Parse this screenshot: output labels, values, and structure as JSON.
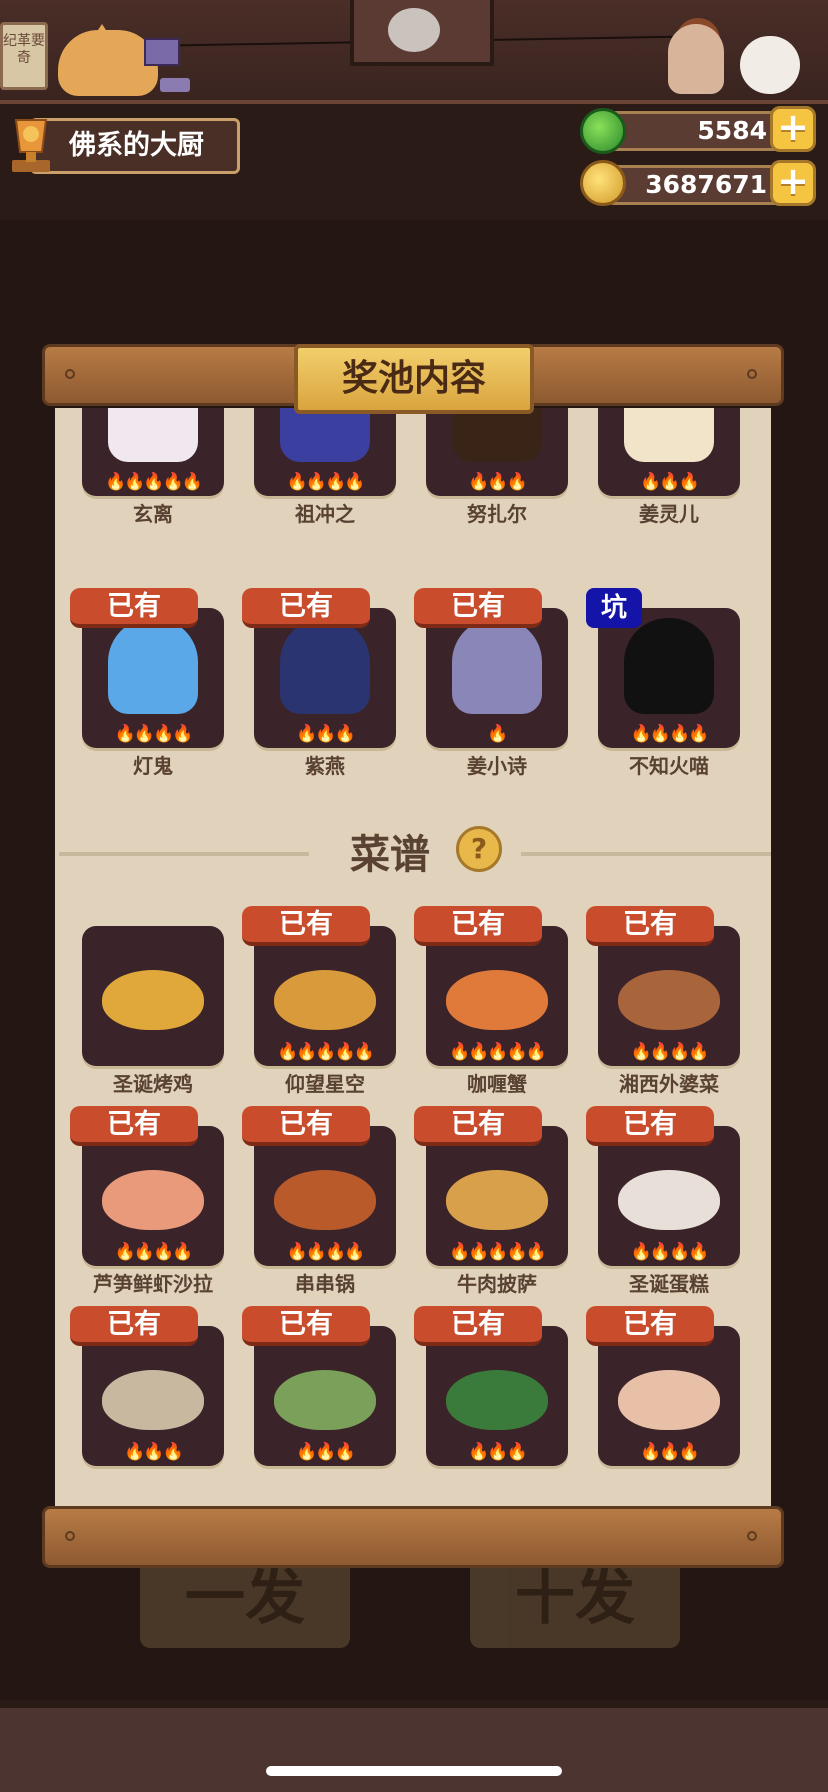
{
  "hud": {
    "player_name": "佛系的大厨",
    "jade": "5584",
    "coins": "3687671",
    "plus": "+",
    "sign_text": "纪革要奇"
  },
  "background_buttons": {
    "single": "一发",
    "ten": "十发"
  },
  "panel": {
    "title": "奖池内容",
    "recipes_section": "菜谱",
    "help": "?"
  },
  "badges": {
    "owned": "已有",
    "pit": "坑"
  },
  "characters": [
    {
      "name": "玄离",
      "flames": "🔥🔥🔥🔥🔥",
      "owned": false,
      "color": "#f0e8ee"
    },
    {
      "name": "祖冲之",
      "flames": "🔥🔥🔥🔥",
      "owned": false,
      "color": "#3a3fa0"
    },
    {
      "name": "努扎尔",
      "flames": "🔥🔥🔥",
      "owned": false,
      "color": "#3a2418"
    },
    {
      "name": "姜灵儿",
      "flames": "🔥🔥🔥",
      "owned": false,
      "color": "#f2e4c8"
    },
    {
      "name": "灯鬼",
      "flames": "🔥🔥🔥🔥",
      "owned": true,
      "color": "#5aa8e8"
    },
    {
      "name": "紫燕",
      "flames": "🔥🔥🔥",
      "owned": true,
      "color": "#2a3470"
    },
    {
      "name": "姜小诗",
      "flames": "🔥",
      "owned": true,
      "color": "#8a86b8"
    },
    {
      "name": "不知火喵",
      "flames": "🔥🔥🔥🔥",
      "owned": false,
      "pit": true,
      "color": "#111111"
    }
  ],
  "recipes": [
    {
      "name": "圣诞烤鸡",
      "flames": "",
      "owned": false,
      "color": "#e0a83a"
    },
    {
      "name": "仰望星空",
      "flames": "🔥🔥🔥🔥🔥",
      "owned": true,
      "color": "#d89a3a"
    },
    {
      "name": "咖喱蟹",
      "flames": "🔥🔥🔥🔥🔥",
      "owned": true,
      "color": "#e07a3a"
    },
    {
      "name": "湘西外婆菜",
      "flames": "🔥🔥🔥🔥",
      "owned": true,
      "color": "#a8643a"
    },
    {
      "name": "芦笋鲜虾沙拉",
      "flames": "🔥🔥🔥🔥",
      "owned": true,
      "color": "#e89a7a"
    },
    {
      "name": "串串锅",
      "flames": "🔥🔥🔥🔥",
      "owned": true,
      "color": "#b85a2a"
    },
    {
      "name": "牛肉披萨",
      "flames": "🔥🔥🔥🔥🔥",
      "owned": true,
      "color": "#d8a04a"
    },
    {
      "name": "圣诞蛋糕",
      "flames": "🔥🔥🔥🔥",
      "owned": true,
      "color": "#e8e0d8"
    },
    {
      "name": "",
      "flames": "🔥🔥🔥",
      "owned": true,
      "color": "#c8b8a0"
    },
    {
      "name": "",
      "flames": "🔥🔥🔥",
      "owned": true,
      "color": "#7aa05a"
    },
    {
      "name": "",
      "flames": "🔥🔥🔥",
      "owned": true,
      "color": "#3a7a3a"
    },
    {
      "name": "",
      "flames": "🔥🔥🔥",
      "owned": true,
      "color": "#e8c0a8"
    }
  ]
}
